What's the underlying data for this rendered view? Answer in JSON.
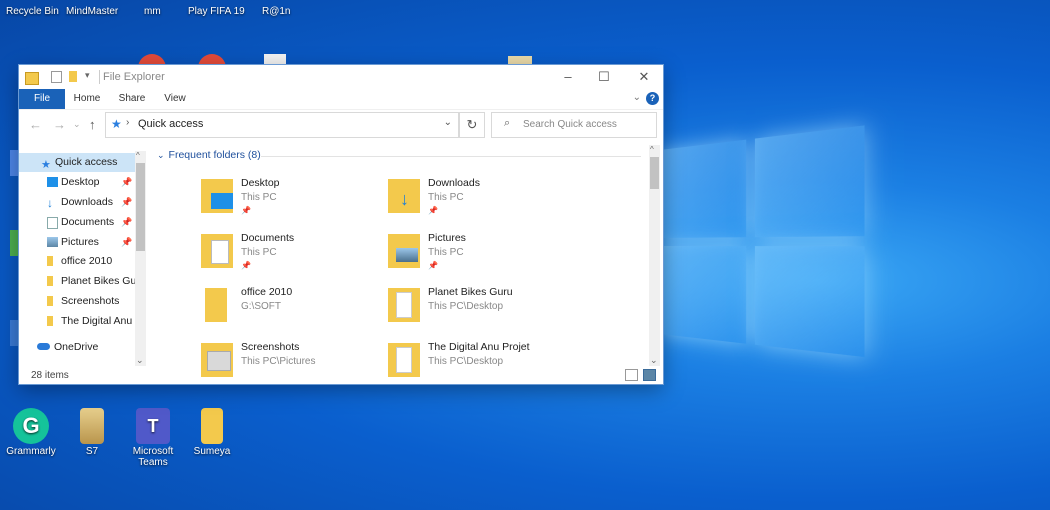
{
  "desktop": {
    "top_labels": [
      "Recycle Bin",
      "MindMaster",
      "mm",
      "Play FIFA 19",
      "R@1n"
    ],
    "bottom_icons": [
      {
        "label": "Grammarly",
        "icon": "grammarly-icon",
        "color": "#15c39a"
      },
      {
        "label": "S7",
        "icon": "s7-icon",
        "color": "#d8b46b"
      },
      {
        "label": "Microsoft Teams",
        "icon": "teams-icon",
        "color": "#5059c9"
      },
      {
        "label": "Sumeya",
        "icon": "folder-icon",
        "color": "#f3c94c"
      }
    ]
  },
  "window": {
    "title": "File Explorer",
    "ribbon_tabs": [
      "File",
      "Home",
      "Share",
      "View"
    ],
    "address": "Quick access",
    "search_placeholder": "Search Quick access",
    "nav": {
      "items": [
        {
          "label": "Quick access",
          "pinned": false
        },
        {
          "label": "Desktop",
          "pinned": true
        },
        {
          "label": "Downloads",
          "pinned": true
        },
        {
          "label": "Documents",
          "pinned": true
        },
        {
          "label": "Pictures",
          "pinned": true
        },
        {
          "label": "office 2010",
          "pinned": false
        },
        {
          "label": "Planet Bikes Guru",
          "pinned": false
        },
        {
          "label": "Screenshots",
          "pinned": false
        },
        {
          "label": "The Digital Anu P",
          "pinned": false
        }
      ],
      "onedrive": "OneDrive"
    },
    "group_header": "Frequent folders (8)",
    "folders": [
      {
        "name": "Desktop",
        "path": "This PC",
        "pinned": true
      },
      {
        "name": "Downloads",
        "path": "This PC",
        "pinned": true
      },
      {
        "name": "Documents",
        "path": "This PC",
        "pinned": true
      },
      {
        "name": "Pictures",
        "path": "This PC",
        "pinned": true
      },
      {
        "name": "office 2010",
        "path": "G:\\SOFT",
        "pinned": false
      },
      {
        "name": "Planet Bikes Guru",
        "path": "This PC\\Desktop",
        "pinned": false
      },
      {
        "name": "Screenshots",
        "path": "This PC\\Pictures",
        "pinned": false
      },
      {
        "name": "The Digital Anu Projet",
        "path": "This PC\\Desktop",
        "pinned": false
      }
    ],
    "status": "28 items",
    "colors": {
      "accent": "#1a62b8",
      "folder": "#f3c94c",
      "group_header": "#1e4f9c"
    }
  }
}
